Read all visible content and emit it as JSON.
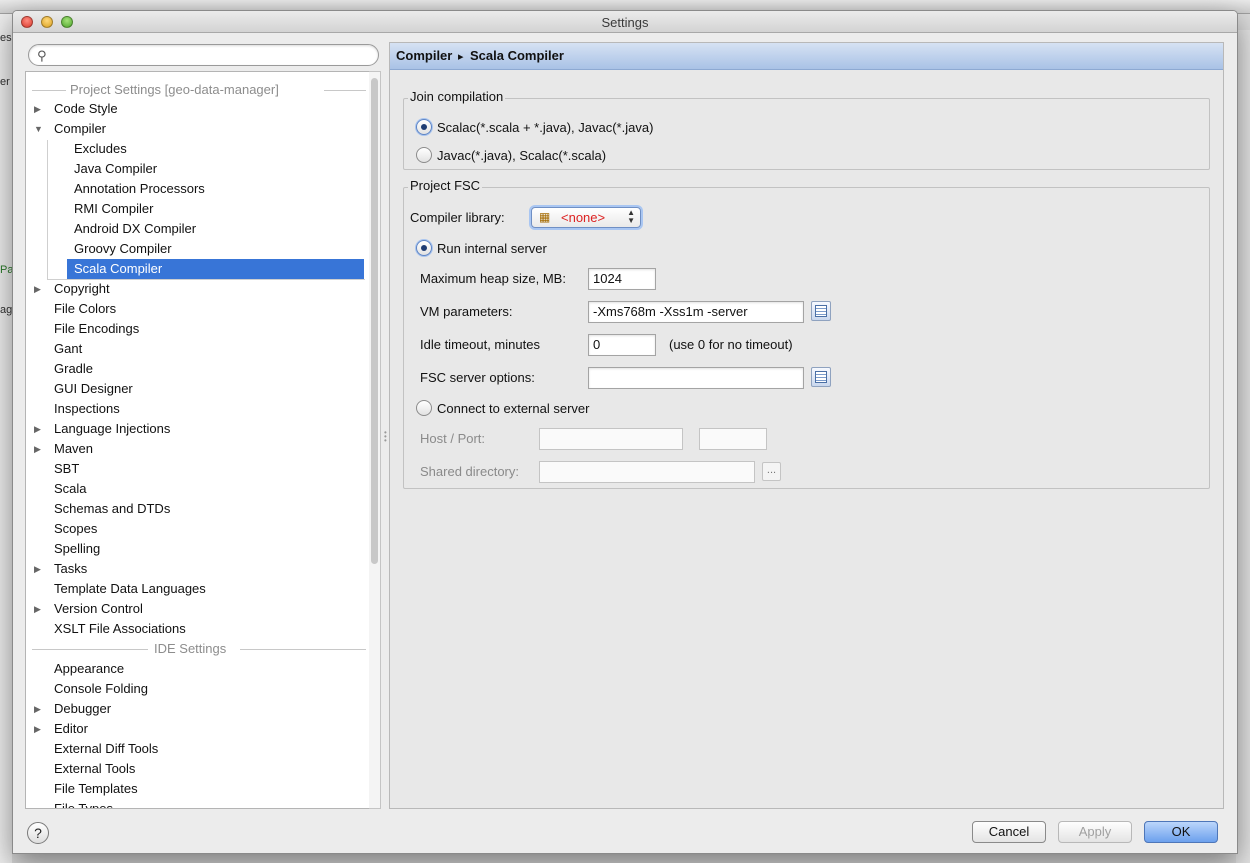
{
  "window": {
    "title": "Settings"
  },
  "background": {
    "fragments": [
      "es",
      "er",
      "Pa",
      "ag"
    ]
  },
  "sidebar": {
    "search": {
      "placeholder": ""
    },
    "project_header": "Project Settings [geo-data-manager]",
    "ide_header": "IDE Settings",
    "project_items": [
      {
        "label": "Code Style",
        "expandable": true,
        "expanded": false
      },
      {
        "label": "Compiler",
        "expandable": true,
        "expanded": true
      },
      {
        "label": "Copyright",
        "expandable": true,
        "expanded": false
      },
      {
        "label": "File Colors",
        "expandable": false
      },
      {
        "label": "File Encodings",
        "expandable": false
      },
      {
        "label": "Gant",
        "expandable": false
      },
      {
        "label": "Gradle",
        "expandable": false
      },
      {
        "label": "GUI Designer",
        "expandable": false
      },
      {
        "label": "Inspections",
        "expandable": false
      },
      {
        "label": "Language Injections",
        "expandable": true,
        "expanded": false
      },
      {
        "label": "Maven",
        "expandable": true,
        "expanded": false
      },
      {
        "label": "SBT",
        "expandable": false
      },
      {
        "label": "Scala",
        "expandable": false
      },
      {
        "label": "Schemas and DTDs",
        "expandable": false
      },
      {
        "label": "Scopes",
        "expandable": false
      },
      {
        "label": "Spelling",
        "expandable": false
      },
      {
        "label": "Tasks",
        "expandable": true,
        "expanded": false
      },
      {
        "label": "Template Data Languages",
        "expandable": false
      },
      {
        "label": "Version Control",
        "expandable": true,
        "expanded": false
      },
      {
        "label": "XSLT File Associations",
        "expandable": false
      }
    ],
    "compiler_children": [
      "Excludes",
      "Java Compiler",
      "Annotation Processors",
      "RMI Compiler",
      "Android DX Compiler",
      "Groovy Compiler",
      "Scala Compiler"
    ],
    "selected_child": "Scala Compiler",
    "ide_items": [
      {
        "label": "Appearance",
        "expandable": false
      },
      {
        "label": "Console Folding",
        "expandable": false
      },
      {
        "label": "Debugger",
        "expandable": true,
        "expanded": false
      },
      {
        "label": "Editor",
        "expandable": true,
        "expanded": false
      },
      {
        "label": "External Diff Tools",
        "expandable": false
      },
      {
        "label": "External Tools",
        "expandable": false
      },
      {
        "label": "File Templates",
        "expandable": false
      },
      {
        "label": "File Types",
        "expandable": false
      }
    ]
  },
  "breadcrumb": {
    "parent": "Compiler",
    "separator": "▸",
    "current": "Scala Compiler"
  },
  "join": {
    "legend": "Join compilation",
    "option_scalac": "Scalac(*.scala + *.java), Javac(*.java)",
    "option_javac": "Javac(*.java), Scalac(*.scala)",
    "selected": "scalac"
  },
  "fsc": {
    "legend": "Project FSC",
    "library_label": "Compiler library:",
    "library_value": "<none>",
    "run_internal": "Run internal server",
    "heap_label": "Maximum heap size, MB:",
    "heap_value": "1024",
    "vm_label": "VM parameters:",
    "vm_value": "-Xms768m -Xss1m -server",
    "idle_label": "Idle timeout, minutes",
    "idle_value": "0",
    "idle_hint": "(use 0 for no timeout)",
    "options_label": "FSC server options:",
    "options_value": "",
    "connect_external": "Connect to external server",
    "host_label": "Host / Port:",
    "host_value": "",
    "port_value": "",
    "shared_label": "Shared directory:",
    "shared_value": "",
    "browse": "...",
    "server_mode": "internal"
  },
  "buttons": {
    "help": "?",
    "cancel": "Cancel",
    "apply": "Apply",
    "ok": "OK"
  },
  "colors": {
    "selection": "#3875d7",
    "header_gradient_top": "#d6e2f3",
    "none_value": "#dd2222"
  }
}
